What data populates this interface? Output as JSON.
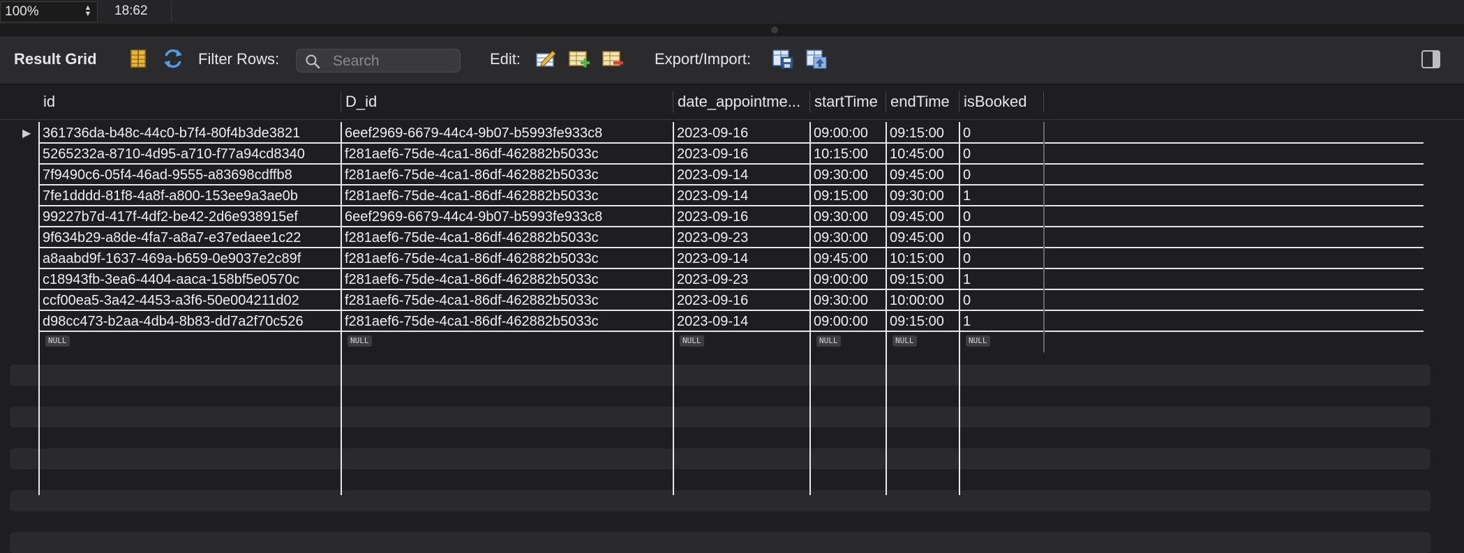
{
  "statusbar": {
    "zoom": "100%",
    "position": "18:62"
  },
  "toolbar": {
    "title": "Result Grid",
    "filter_label": "Filter Rows:",
    "search_placeholder": "Search",
    "edit_label": "Edit:",
    "export_label": "Export/Import:"
  },
  "columns": [
    "id",
    "D_id",
    "date_appointme...",
    "startTime",
    "endTime",
    "isBooked"
  ],
  "rows": [
    [
      "361736da-b48c-44c0-b7f4-80f4b3de3821",
      "6eef2969-6679-44c4-9b07-b5993fe933c8",
      "2023-09-16",
      "09:00:00",
      "09:15:00",
      "0"
    ],
    [
      "5265232a-8710-4d95-a710-f77a94cd8340",
      "f281aef6-75de-4ca1-86df-462882b5033c",
      "2023-09-16",
      "10:15:00",
      "10:45:00",
      "0"
    ],
    [
      "7f9490c6-05f4-46ad-9555-a83698cdffb8",
      "f281aef6-75de-4ca1-86df-462882b5033c",
      "2023-09-14",
      "09:30:00",
      "09:45:00",
      "0"
    ],
    [
      "7fe1dddd-81f8-4a8f-a800-153ee9a3ae0b",
      "f281aef6-75de-4ca1-86df-462882b5033c",
      "2023-09-14",
      "09:15:00",
      "09:30:00",
      "1"
    ],
    [
      "99227b7d-417f-4df2-be42-2d6e938915ef",
      "6eef2969-6679-44c4-9b07-b5993fe933c8",
      "2023-09-16",
      "09:30:00",
      "09:45:00",
      "0"
    ],
    [
      "9f634b29-a8de-4fa7-a8a7-e37edaee1c22",
      "f281aef6-75de-4ca1-86df-462882b5033c",
      "2023-09-23",
      "09:30:00",
      "09:45:00",
      "0"
    ],
    [
      "a8aabd9f-1637-469a-b659-0e9037e2c89f",
      "f281aef6-75de-4ca1-86df-462882b5033c",
      "2023-09-14",
      "09:45:00",
      "10:15:00",
      "0"
    ],
    [
      "c18943fb-3ea6-4404-aaca-158bf5e0570c",
      "f281aef6-75de-4ca1-86df-462882b5033c",
      "2023-09-23",
      "09:00:00",
      "09:15:00",
      "1"
    ],
    [
      "ccf00ea5-3a42-4453-a3f6-50e004211d02",
      "f281aef6-75de-4ca1-86df-462882b5033c",
      "2023-09-16",
      "09:30:00",
      "10:00:00",
      "0"
    ],
    [
      "d98cc473-b2aa-4db4-8b83-dd7a2f70c526",
      "f281aef6-75de-4ca1-86df-462882b5033c",
      "2023-09-14",
      "09:00:00",
      "09:15:00",
      "1"
    ]
  ],
  "null_label": "NULL",
  "current_row_marker": "▶",
  "icons": {
    "form_editor": "form-editor-icon",
    "refresh": "refresh-icon",
    "search": "search-icon",
    "edit_row": "edit-row-icon",
    "add_row": "add-row-icon",
    "delete_row": "delete-row-icon",
    "export": "export-icon",
    "import": "import-icon",
    "toggle_panel": "sidebar-toggle-icon"
  }
}
